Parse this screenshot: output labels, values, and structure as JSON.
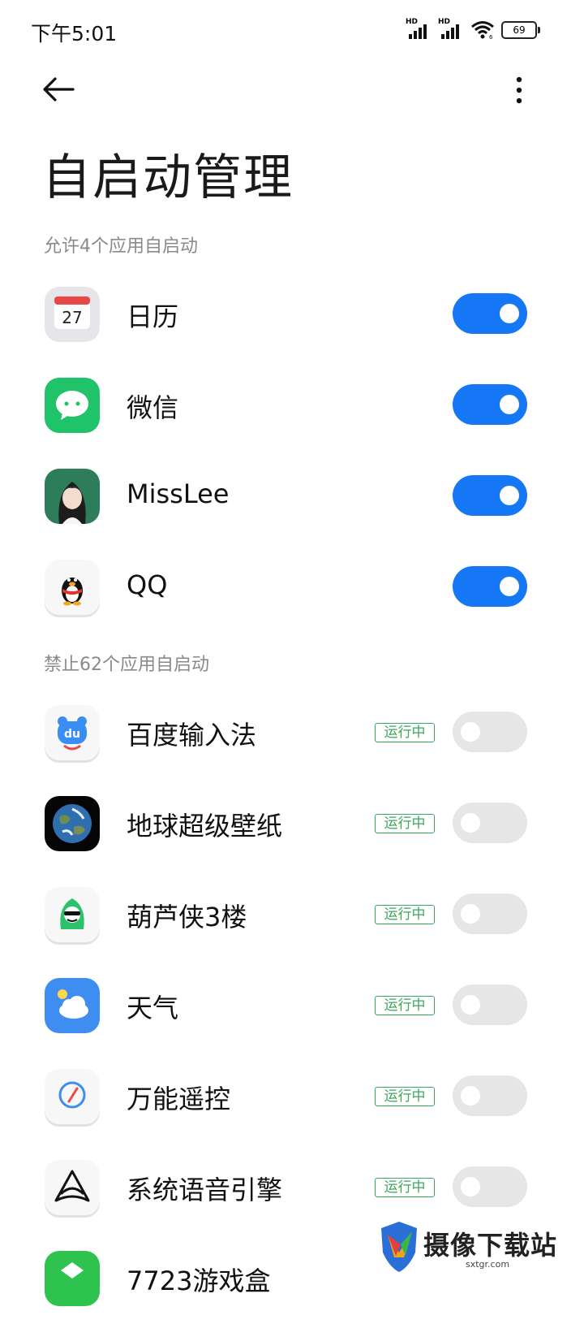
{
  "status": {
    "time": "下午5:01",
    "hd1": "HD",
    "hd2": "HD",
    "wifi_sub": "6",
    "battery": "69"
  },
  "header": {
    "title": "自启动管理"
  },
  "sections": {
    "allowed_label": "允许4个应用自启动",
    "blocked_label": "禁止62个应用自启动"
  },
  "calendar_icon_text": "27",
  "baidu_icon_text": "du",
  "allowed_apps": [
    {
      "name": "日历",
      "enabled": true,
      "icon": "calendar-icon"
    },
    {
      "name": "微信",
      "enabled": true,
      "icon": "wechat-icon"
    },
    {
      "name": "MissLee",
      "enabled": true,
      "icon": "misslee-avatar-icon"
    },
    {
      "name": "QQ",
      "enabled": true,
      "icon": "qq-penguin-icon"
    }
  ],
  "blocked_apps": [
    {
      "name": "百度输入法",
      "status": "运行中",
      "enabled": false,
      "icon": "baidu-input-icon"
    },
    {
      "name": "地球超级壁纸",
      "status": "运行中",
      "enabled": false,
      "icon": "earth-icon"
    },
    {
      "name": "葫芦侠3楼",
      "status": "运行中",
      "enabled": false,
      "icon": "huluxia-icon"
    },
    {
      "name": "天气",
      "status": "运行中",
      "enabled": false,
      "icon": "weather-icon"
    },
    {
      "name": "万能遥控",
      "status": "运行中",
      "enabled": false,
      "icon": "remote-compass-icon"
    },
    {
      "name": "系统语音引擎",
      "status": "运行中",
      "enabled": false,
      "icon": "voice-engine-icon"
    },
    {
      "name": "7723游戏盒",
      "icon": "game-box-icon"
    }
  ],
  "watermark": {
    "text": "摄像下载站",
    "url": "sxtgr.com"
  },
  "colors": {
    "toggle_on": "#1677f6",
    "toggle_off": "#e6e6e6",
    "running_badge": "#3aa85a"
  }
}
